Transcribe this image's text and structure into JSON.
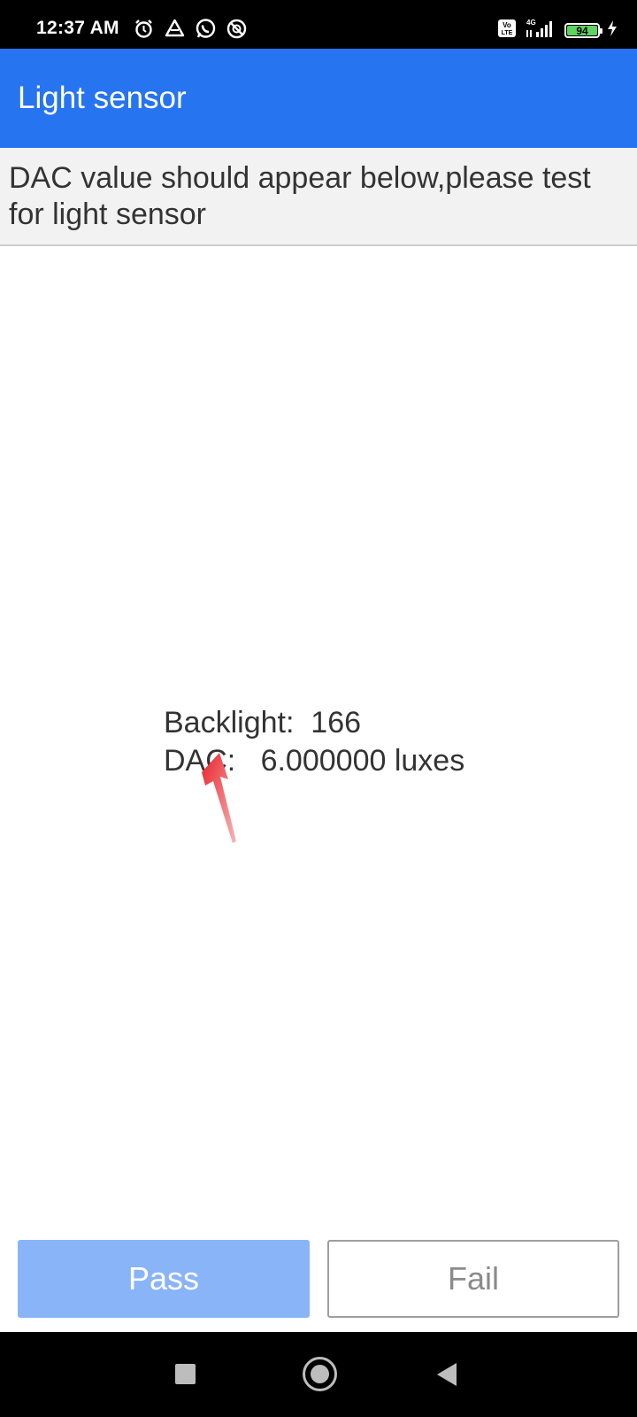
{
  "status_bar": {
    "time": "12:37 AM",
    "battery_level": "94",
    "network": "4G",
    "volte": "Vo LTE"
  },
  "app_bar": {
    "title": "Light sensor"
  },
  "instruction": {
    "text": "DAC value should appear below,please test for light sensor"
  },
  "readings": {
    "backlight": "Backlight:  166",
    "dac": "DAC:   6.000000 luxes"
  },
  "buttons": {
    "pass_label": "Pass",
    "fail_label": "Fail"
  },
  "colors": {
    "app_bar": "#2674f0",
    "pass_button": "#8ab4f8",
    "annotation_arrow": "#e8232b"
  },
  "icons": {
    "status_left": [
      "alarm-icon",
      "drive-icon",
      "whatsapp-icon",
      "dnd-icon"
    ],
    "status_right": [
      "volte-icon",
      "signal-icon",
      "battery-icon",
      "charging-icon"
    ],
    "nav": [
      "recents-icon",
      "home-icon",
      "back-icon"
    ]
  }
}
